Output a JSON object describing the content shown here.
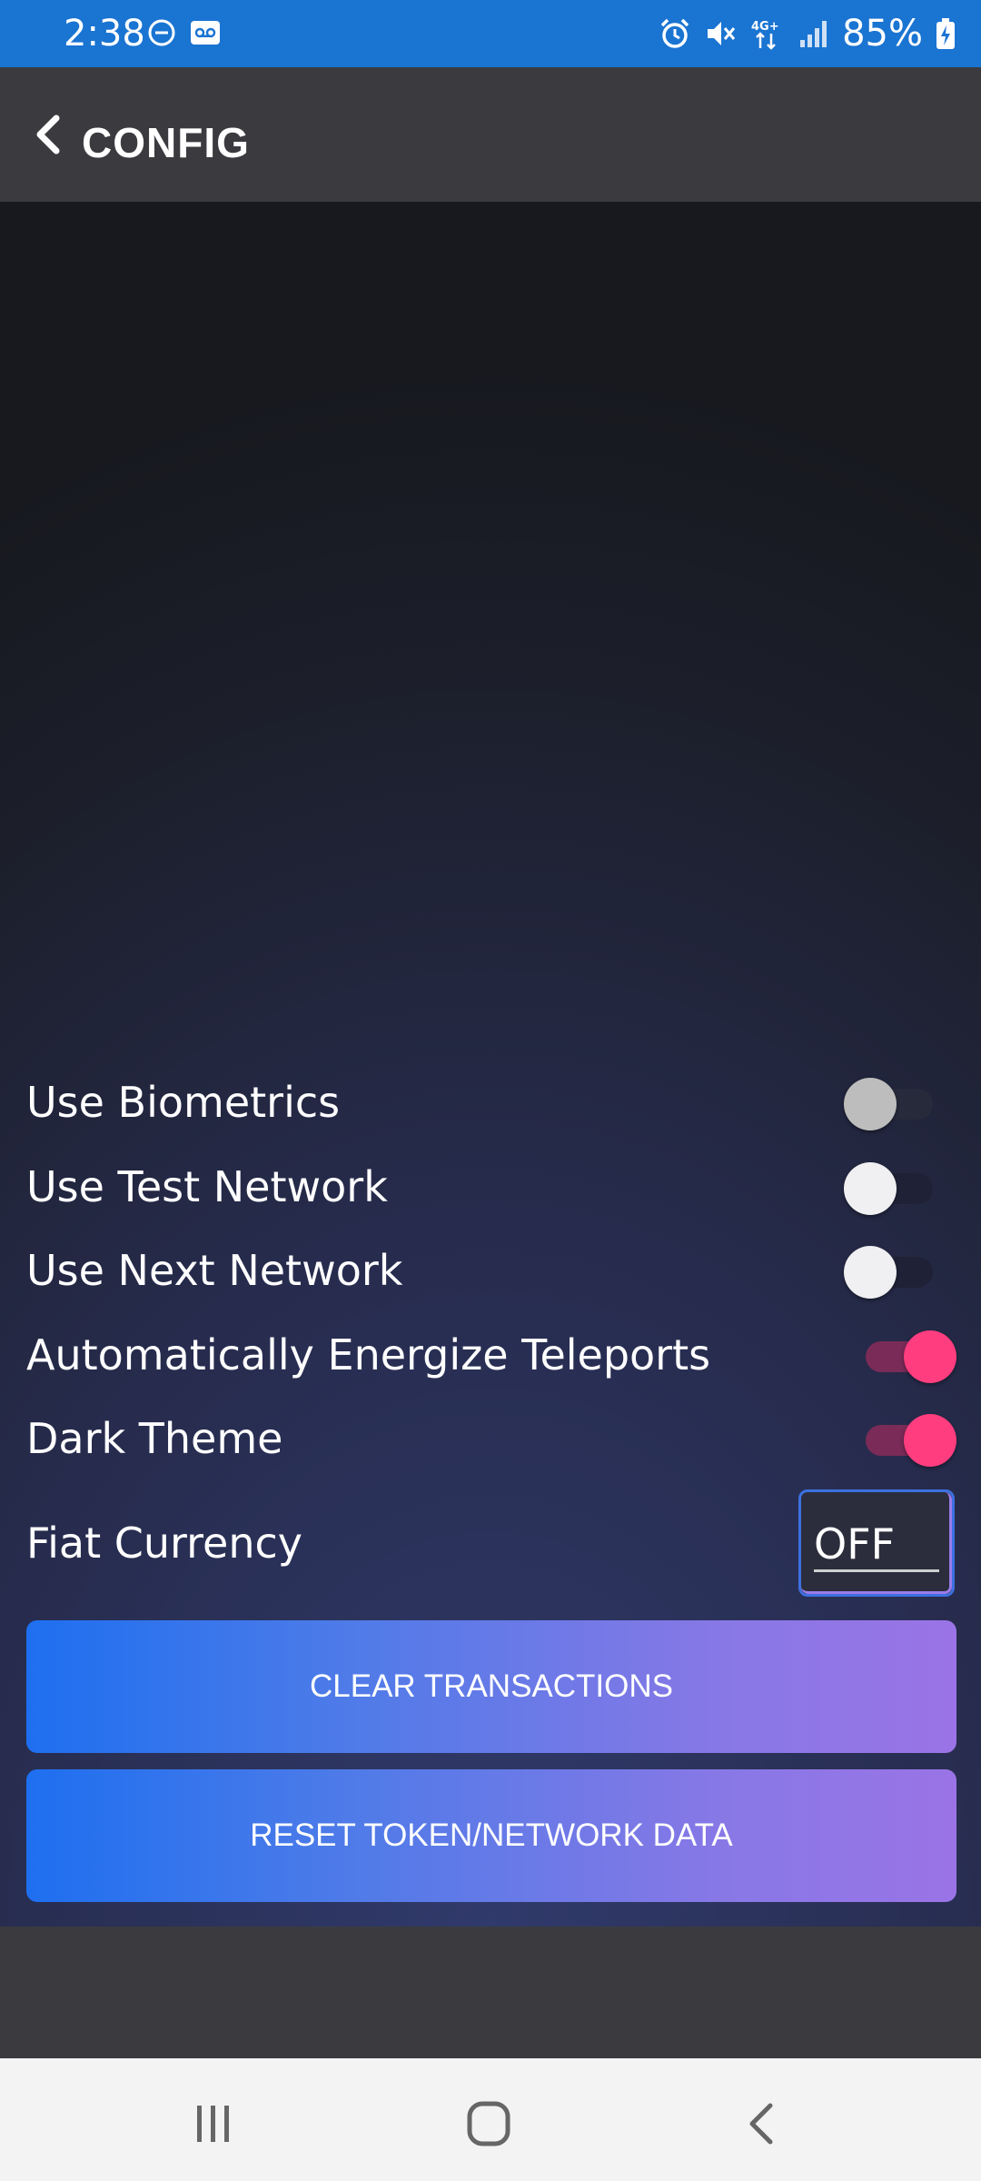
{
  "status_bar": {
    "time": "2:38",
    "battery": "85%",
    "network": "4G+"
  },
  "app_bar": {
    "title": "CONFIG",
    "back_icon": "chevron-left-icon"
  },
  "settings": {
    "items": [
      {
        "label": "Use Biometrics",
        "enabled": false,
        "disabled": true
      },
      {
        "label": "Use Test Network",
        "enabled": false
      },
      {
        "label": "Use Next Network",
        "enabled": false
      },
      {
        "label": "Automatically Energize Teleports",
        "enabled": true
      },
      {
        "label": "Dark Theme",
        "enabled": true
      }
    ],
    "fiat": {
      "label": "Fiat Currency",
      "value": "OFF"
    }
  },
  "buttons": {
    "clear": "CLEAR TRANSACTIONS",
    "reset": "RESET TOKEN/NETWORK DATA"
  },
  "colors": {
    "status_bar": "#1a74d2",
    "toggle_on": "#ff3d7f",
    "button_gradient_start": "#1e6ff0",
    "button_gradient_end": "#9a74e6"
  },
  "nav": {
    "recents_icon": "recents-icon",
    "home_icon": "home-icon",
    "back_icon": "back-icon"
  }
}
